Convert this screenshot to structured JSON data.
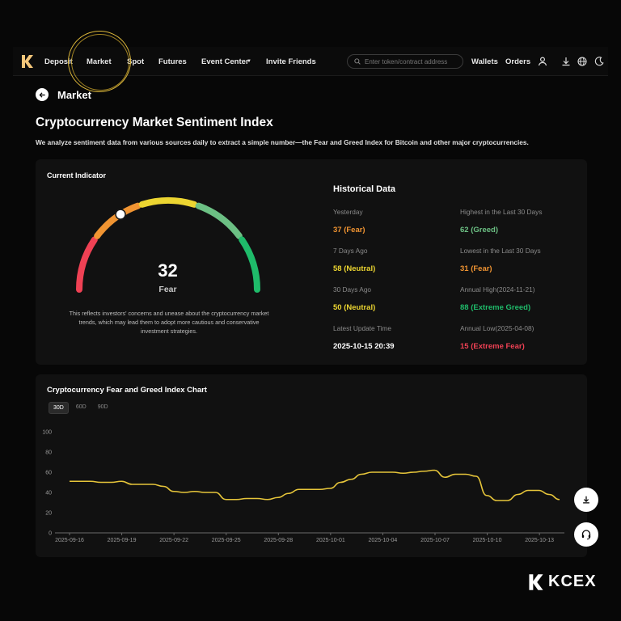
{
  "nav": {
    "items": [
      {
        "label": "Deposit",
        "x": 55
      },
      {
        "label": "Market",
        "x": 107
      },
      {
        "label": "Spot",
        "x": 157
      },
      {
        "label": "Futures",
        "x": 196
      },
      {
        "label": "Event Center",
        "x": 249
      },
      {
        "label": "Invite Friends",
        "x": 329
      }
    ],
    "search_placeholder": "Enter token/contract address",
    "wallets": "Wallets",
    "orders": "Orders"
  },
  "breadcrumb": "Market",
  "page": {
    "title": "Cryptocurrency Market Sentiment Index",
    "subtitle": "We analyze sentiment data from various sources daily to extract a simple number—the Fear and Greed Index for Bitcoin and other major cryptocurrencies."
  },
  "indicator": {
    "title": "Current Indicator",
    "value": "32",
    "level": 32,
    "label": "Fear",
    "description": "This reflects investors' concerns and unease about the cryptocurrency market trends, which may lead them to adopt more cautious and conservative investment strategies."
  },
  "history": {
    "title": "Historical Data",
    "rows": [
      {
        "k1": "Yesterday",
        "v1": "37 (Fear)",
        "c1": "#f09432",
        "k2": "Highest in the Last 30 Days",
        "v2": "62 (Greed)",
        "c2": "#6cc084"
      },
      {
        "k1": "7 Days Ago",
        "v1": "58 (Neutral)",
        "c1": "#ecd531",
        "k2": "Lowest in the Last 30 Days",
        "v2": "31 (Fear)",
        "c2": "#f09432"
      },
      {
        "k1": "30 Days Ago",
        "v1": "50 (Neutral)",
        "c1": "#ecd531",
        "k2": "Annual High(2024-11-21)",
        "v2": "88 (Extreme Greed)",
        "c2": "#1fbb6a"
      },
      {
        "k1": "Latest Update Time",
        "v1": "2025-10-15 20:39",
        "c1": "#ffffff",
        "k2": "Annual Low(2025-04-08)",
        "v2": "15 (Extreme Fear)",
        "c2": "#ef4154"
      }
    ]
  },
  "chart_section": {
    "title": "Cryptocurrency Fear and Greed Index Chart",
    "tabs": [
      "30D",
      "60D",
      "90D"
    ],
    "active_tab": "30D"
  },
  "chart_data": {
    "type": "line",
    "ylim": [
      0,
      100
    ],
    "yticks": [
      0,
      20,
      40,
      60,
      80,
      100
    ],
    "xtick_labels": [
      "2025-09-16",
      "2025-09-19",
      "2025-09-22",
      "2025-09-25",
      "2025-09-28",
      "2025-10-01",
      "2025-10-04",
      "2025-10-07",
      "2025-10-10",
      "2025-10-13"
    ],
    "series": [
      {
        "color": "#e6c53a",
        "values": [
          51,
          51,
          51,
          50,
          50,
          51,
          48,
          48,
          48,
          46,
          41,
          40,
          41,
          40,
          40,
          33,
          33,
          34,
          34,
          33,
          35,
          39,
          43,
          43,
          43,
          44,
          50,
          53,
          58,
          60,
          60,
          60,
          59,
          60,
          61,
          62,
          55,
          58,
          58,
          56,
          37,
          32,
          32,
          38,
          42,
          42,
          38,
          33
        ]
      }
    ]
  },
  "brand": {
    "name": "KCEX"
  }
}
